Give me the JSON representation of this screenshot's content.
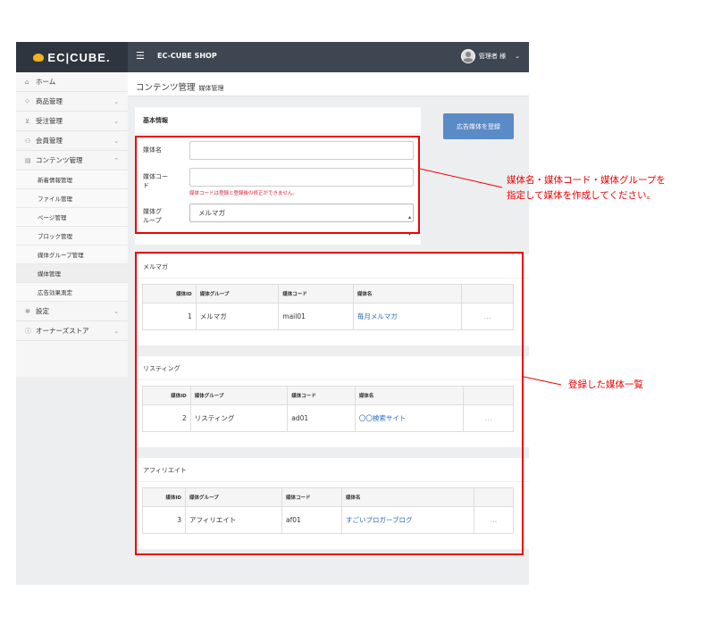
{
  "app": {
    "logo": "EC|CUBE.",
    "shop_name": "EC-CUBE SHOP",
    "user_label": "管理者 様"
  },
  "sidebar": {
    "items": [
      {
        "icon": "home-icon",
        "glyph": "⌂",
        "label": "ホーム"
      },
      {
        "icon": "tag-icon",
        "glyph": "⬦",
        "label": "商品管理"
      },
      {
        "icon": "cart-icon",
        "glyph": "⊻",
        "label": "受注管理"
      },
      {
        "icon": "users-icon",
        "glyph": "⚇",
        "label": "会員管理"
      },
      {
        "icon": "file-icon",
        "glyph": "▤",
        "label": "コンテンツ管理"
      }
    ],
    "subitems": [
      "新着情報管理",
      "ファイル管理",
      "ページ管理",
      "ブロック管理",
      "媒体グループ管理",
      "媒体管理",
      "広告効果測定"
    ],
    "bottom": [
      {
        "icon": "gear-icon",
        "glyph": "✻",
        "label": "設定"
      },
      {
        "icon": "info-icon",
        "glyph": "ⓘ",
        "label": "オーナーズストア"
      }
    ]
  },
  "page": {
    "title": "コンテンツ管理",
    "subtitle": "媒体管理"
  },
  "form": {
    "heading": "基本情報",
    "name_label": "媒体名",
    "code_label": "媒体コー\nド",
    "code_help": "媒体コードは登録と登録後の修正ができません。",
    "group_label": "媒体グ\nループ",
    "group_value": "メルマガ",
    "register_button": "広告媒体を登録"
  },
  "headers": {
    "id": "媒体ID",
    "group": "媒体グループ",
    "code": "媒体コード",
    "name": "媒体名"
  },
  "groups": [
    {
      "title": "メルマガ",
      "row": {
        "id": "1",
        "group": "メルマガ",
        "code": "mail01",
        "name": "毎月メルマガ",
        "action": "…"
      }
    },
    {
      "title": "リスティング",
      "row": {
        "id": "2",
        "group": "リスティング",
        "code": "ad01",
        "name": "〇〇検索サイト",
        "action": "…"
      }
    },
    {
      "title": "アフィリエイト",
      "row": {
        "id": "3",
        "group": "アフィリエイト",
        "code": "af01",
        "name": "すごいブロガーブログ",
        "action": "…"
      }
    }
  ],
  "annotations": {
    "note1_line1": "媒体名・媒体コード・媒体グループを",
    "note1_line2": "指定して媒体を作成してください。",
    "note2": "登録した媒体一覧"
  },
  "colors": {
    "topbar": "#3d4651",
    "accent_button": "#5a8bc6",
    "annotation_red": "#ee0000",
    "link": "#2a6ab5"
  }
}
